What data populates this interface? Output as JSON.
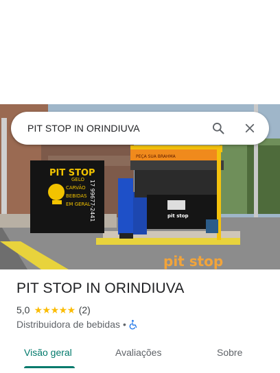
{
  "search": {
    "query": "PIT STOP IN ORINDIUVA",
    "search_icon": "search-icon",
    "close_icon": "close-icon"
  },
  "photo": {
    "wall_sign_title": "PIT STOP",
    "wall_sign_lines": [
      "GELO",
      "CARVÃO",
      "BEBIDAS",
      "EM GERAL"
    ],
    "wall_phone": "17 99677-2441",
    "counter_logo": "pit stop",
    "floor_text": "pit stop",
    "banner_text": "PEÇA SUA BRAHMA"
  },
  "place": {
    "name": "PIT STOP IN ORINDIUVA",
    "rating": "5,0",
    "stars": "★★★★★",
    "review_count": "(2)",
    "category": "Distribuidora de bebidas",
    "separator": "•",
    "accessibility_icon": "wheelchair-icon"
  },
  "tabs": [
    {
      "label": "Visão geral",
      "active": true
    },
    {
      "label": "Avaliações",
      "active": false
    },
    {
      "label": "Sobre",
      "active": false
    }
  ],
  "colors": {
    "accent": "#00796b",
    "star": "#fbbc04",
    "accessibility": "#1a73e8"
  }
}
